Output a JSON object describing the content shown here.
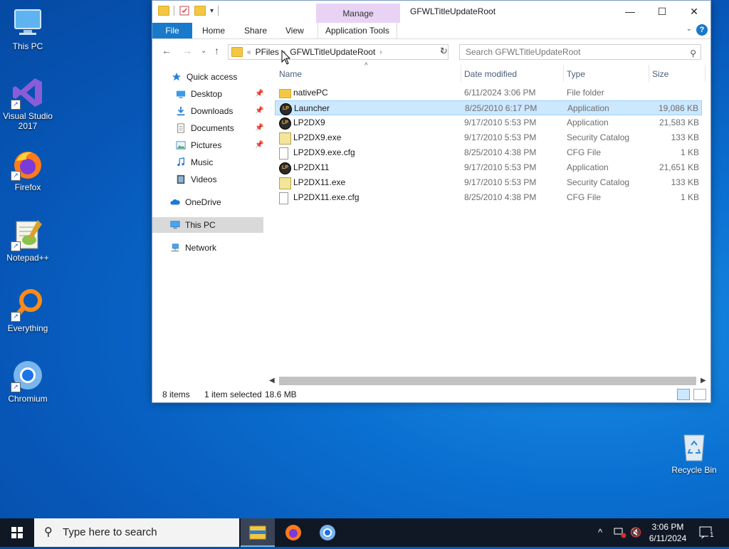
{
  "desktop": {
    "icons": [
      {
        "label": "This PC"
      },
      {
        "label": "Visual Studio 2017"
      },
      {
        "label": "Firefox"
      },
      {
        "label": "Notepad++"
      },
      {
        "label": "Everything"
      },
      {
        "label": "Chromium"
      },
      {
        "label": "Recycle Bin"
      }
    ]
  },
  "window": {
    "title": "GFWLTitleUpdateRoot",
    "manage_tab": "Manage",
    "ribbon_tabs": [
      "File",
      "Home",
      "Share",
      "View",
      "Application Tools"
    ],
    "help_label": "?",
    "address": {
      "prefix": "«",
      "parts": [
        "PFiles",
        "GFWLTitleUpdateRoot"
      ]
    },
    "search_placeholder": "Search GFWLTitleUpdateRoot",
    "columns": [
      "Name",
      "Date modified",
      "Type",
      "Size"
    ],
    "nav_pane": [
      {
        "label": "Quick access",
        "icon": "star-icon"
      },
      {
        "label": "Desktop",
        "icon": "desktop-icon",
        "pinned": true
      },
      {
        "label": "Downloads",
        "icon": "download-icon",
        "pinned": true
      },
      {
        "label": "Documents",
        "icon": "documents-icon",
        "pinned": true
      },
      {
        "label": "Pictures",
        "icon": "pictures-icon",
        "pinned": true
      },
      {
        "label": "Music",
        "icon": "music-icon"
      },
      {
        "label": "Videos",
        "icon": "videos-icon"
      },
      {
        "label": "OneDrive",
        "icon": "cloud-icon"
      },
      {
        "label": "This PC",
        "icon": "computer-icon",
        "selected": true
      },
      {
        "label": "Network",
        "icon": "network-icon"
      }
    ],
    "files": [
      {
        "name": "nativePC",
        "date": "6/11/2024 3:06 PM",
        "type": "File folder",
        "size": "",
        "kind": "folder"
      },
      {
        "name": "Launcher",
        "date": "8/25/2010 6:17 PM",
        "type": "Application",
        "size": "19,086 KB",
        "kind": "app",
        "selected": true
      },
      {
        "name": "LP2DX9",
        "date": "9/17/2010 5:53 PM",
        "type": "Application",
        "size": "21,583 KB",
        "kind": "app"
      },
      {
        "name": "LP2DX9.exe",
        "date": "9/17/2010 5:53 PM",
        "type": "Security Catalog",
        "size": "133 KB",
        "kind": "catalog"
      },
      {
        "name": "LP2DX9.exe.cfg",
        "date": "8/25/2010 4:38 PM",
        "type": "CFG File",
        "size": "1 KB",
        "kind": "cfg"
      },
      {
        "name": "LP2DX11",
        "date": "9/17/2010 5:53 PM",
        "type": "Application",
        "size": "21,651 KB",
        "kind": "app"
      },
      {
        "name": "LP2DX11.exe",
        "date": "9/17/2010 5:53 PM",
        "type": "Security Catalog",
        "size": "133 KB",
        "kind": "catalog"
      },
      {
        "name": "LP2DX11.exe.cfg",
        "date": "8/25/2010 4:38 PM",
        "type": "CFG File",
        "size": "1 KB",
        "kind": "cfg"
      }
    ],
    "status": {
      "count": "8 items",
      "selection": "1 item selected",
      "size": "18.6 MB"
    }
  },
  "taskbar": {
    "search_placeholder": "Type here to search",
    "time": "3:06 PM",
    "date": "6/11/2024",
    "notification_count": "1"
  },
  "colors": {
    "accent": "#1979ca",
    "selection": "#cce8ff",
    "manage_tab": "#e9d3f5",
    "taskbar": "#101826"
  }
}
